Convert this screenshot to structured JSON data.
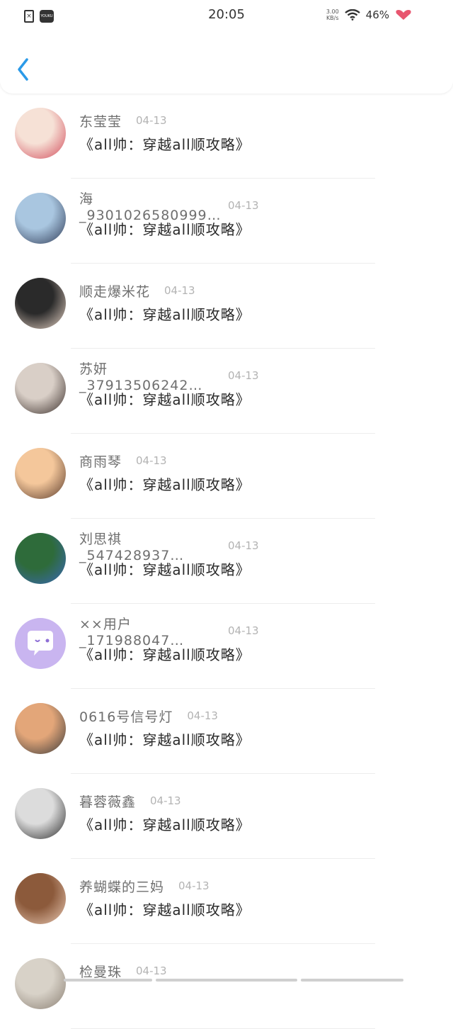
{
  "status_bar": {
    "time": "20:05",
    "app_badge": "YOUKU",
    "net_speed_value": "3.00",
    "net_speed_unit": "KB/s",
    "battery": "46%"
  },
  "conversations": [
    {
      "name": "东莹莹",
      "date": "04-13",
      "message": "《all帅：穿越all顺攻略》",
      "avatar_colors": [
        "#f6e1d6",
        "#d24b5b"
      ]
    },
    {
      "name": "海_9301026580999…",
      "date": "04-13",
      "message": "《all帅：穿越all顺攻略》",
      "avatar_colors": [
        "#a9c6e0",
        "#2e3a55"
      ]
    },
    {
      "name": "顺走爆米花",
      "date": "04-13",
      "message": "《all帅：穿越all顺攻略》",
      "avatar_colors": [
        "#2a2a2a",
        "#e7d3c5"
      ]
    },
    {
      "name": "苏妍_37913506242…",
      "date": "04-13",
      "message": "《all帅：穿越all顺攻略》",
      "avatar_colors": [
        "#d9cfc7",
        "#3a2e2a"
      ]
    },
    {
      "name": "商雨琴",
      "date": "04-13",
      "message": "《all帅：穿越all顺攻略》",
      "avatar_colors": [
        "#f4c79b",
        "#5a3b2b"
      ]
    },
    {
      "name": "刘思祺_547428937…",
      "date": "04-13",
      "message": "《all帅：穿越all顺攻略》",
      "avatar_colors": [
        "#2e6b3a",
        "#3a67b8"
      ]
    },
    {
      "name": "××用户_171988047…",
      "date": "04-13",
      "message": "《all帅：穿越all顺攻略》",
      "avatar_colors": [
        "#c9b5f0",
        "#ffffff"
      ]
    },
    {
      "name": "0616号信号灯",
      "date": "04-13",
      "message": "《all帅：穿越all顺攻略》",
      "avatar_colors": [
        "#e3a679",
        "#3a3a3a"
      ]
    },
    {
      "name": "暮蓉薇鑫",
      "date": "04-13",
      "message": "《all帅：穿越all顺攻略》",
      "avatar_colors": [
        "#dcdcdc",
        "#2b2b2b"
      ]
    },
    {
      "name": "养蝴蝶的三妈",
      "date": "04-13",
      "message": "《all帅：穿越all顺攻略》",
      "avatar_colors": [
        "#8c5a3b",
        "#e9c9b4"
      ]
    },
    {
      "name": "检曼珠",
      "date": "04-13",
      "message": "",
      "avatar_colors": [
        "#d8d2c8",
        "#8a7f73"
      ]
    }
  ],
  "colors": {
    "accent": "#2b9ae8"
  }
}
